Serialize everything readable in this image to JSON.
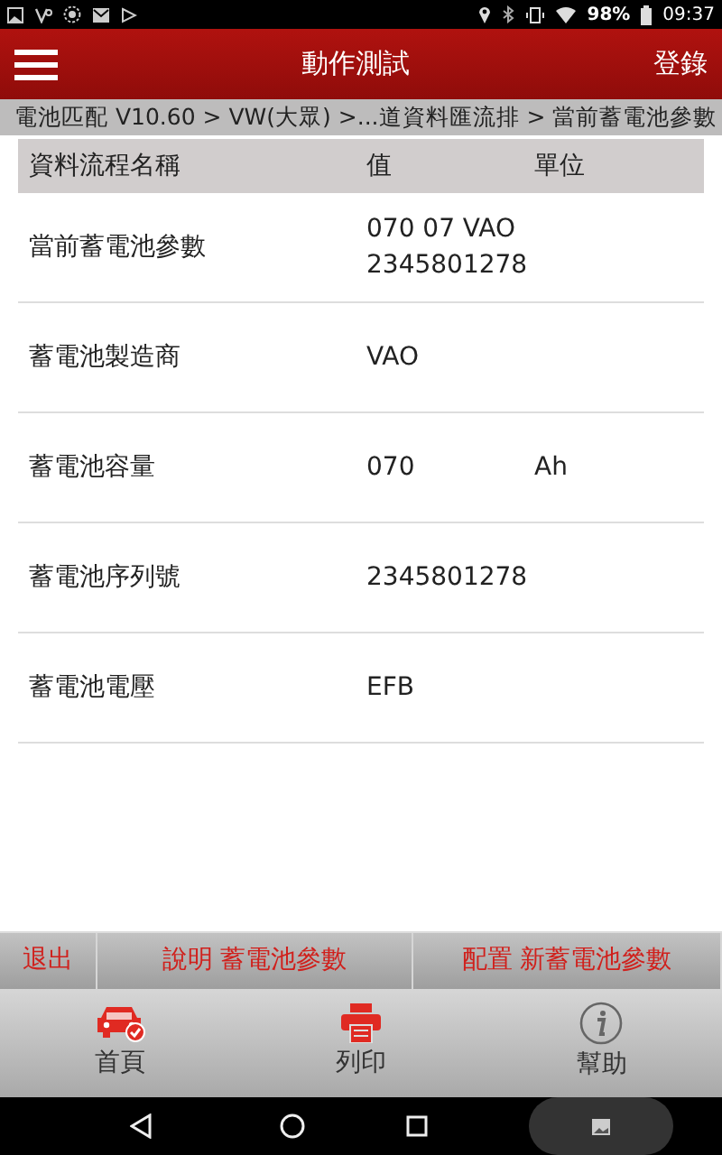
{
  "status_bar": {
    "battery": "98%",
    "time": "09:37"
  },
  "app_bar": {
    "title": "動作測試",
    "action": "登錄"
  },
  "breadcrumb": "電池匹配 V10.60 > VW(大眾) >...道資料匯流排 > 當前蓄電池參數",
  "table": {
    "columns": [
      "資料流程名稱",
      "值",
      "單位"
    ],
    "rows": [
      {
        "name": "當前蓄電池參數",
        "value": "070 07 VAO 2345801278",
        "unit": ""
      },
      {
        "name": "蓄電池製造商",
        "value": "VAO",
        "unit": ""
      },
      {
        "name": "蓄電池容量",
        "value": "070",
        "unit": "Ah"
      },
      {
        "name": "蓄電池序列號",
        "value": "2345801278",
        "unit": ""
      },
      {
        "name": "蓄電池電壓",
        "value": "EFB",
        "unit": ""
      }
    ]
  },
  "actions": [
    "退出",
    "說明 蓄電池參數",
    "配置 新蓄電池參數"
  ],
  "bottom_nav": [
    {
      "label": "首頁",
      "kind": "home"
    },
    {
      "label": "列印",
      "kind": "print"
    },
    {
      "label": "幫助",
      "kind": "help"
    }
  ]
}
